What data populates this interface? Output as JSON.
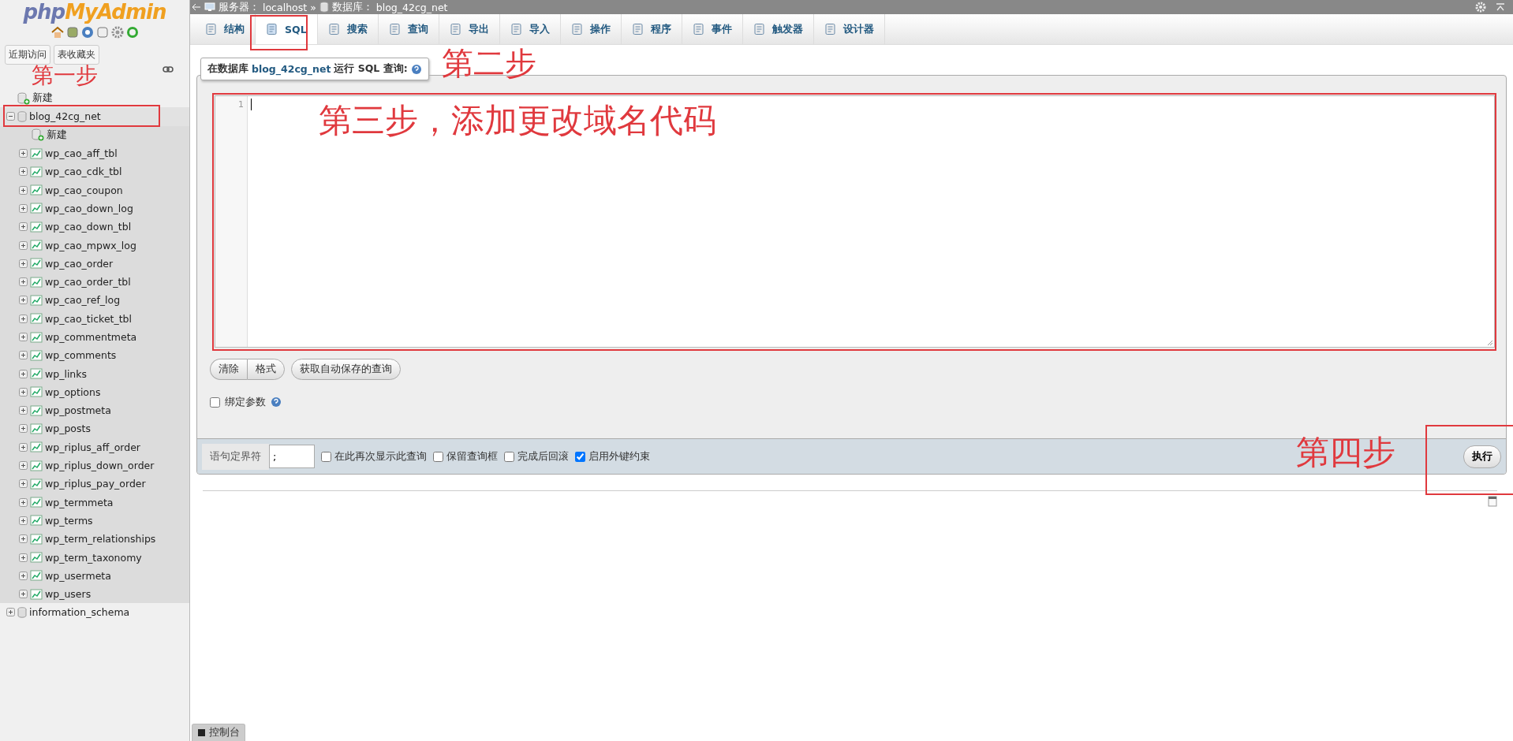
{
  "breadcrumb": {
    "server_label": "服务器：",
    "server": "localhost",
    "separator": "»",
    "db_label": "数据库：",
    "db": "blog_42cg_net"
  },
  "sidebar": {
    "logo": {
      "part1": "php",
      "part2": "MyAdmin"
    },
    "buttons": [
      "近期访问",
      "表收藏夹"
    ],
    "tree": [
      {
        "kind": "new",
        "label": "新建"
      },
      {
        "kind": "db",
        "label": "blog_42cg_net",
        "expanded": true,
        "children": [
          {
            "kind": "new",
            "label": "新建"
          },
          {
            "kind": "table",
            "label": "wp_cao_aff_tbl"
          },
          {
            "kind": "table",
            "label": "wp_cao_cdk_tbl"
          },
          {
            "kind": "table",
            "label": "wp_cao_coupon"
          },
          {
            "kind": "table",
            "label": "wp_cao_down_log"
          },
          {
            "kind": "table",
            "label": "wp_cao_down_tbl"
          },
          {
            "kind": "table",
            "label": "wp_cao_mpwx_log"
          },
          {
            "kind": "table",
            "label": "wp_cao_order"
          },
          {
            "kind": "table",
            "label": "wp_cao_order_tbl"
          },
          {
            "kind": "table",
            "label": "wp_cao_ref_log"
          },
          {
            "kind": "table",
            "label": "wp_cao_ticket_tbl"
          },
          {
            "kind": "table",
            "label": "wp_commentmeta"
          },
          {
            "kind": "table",
            "label": "wp_comments"
          },
          {
            "kind": "table",
            "label": "wp_links"
          },
          {
            "kind": "table",
            "label": "wp_options"
          },
          {
            "kind": "table",
            "label": "wp_postmeta"
          },
          {
            "kind": "table",
            "label": "wp_posts"
          },
          {
            "kind": "table",
            "label": "wp_riplus_aff_order"
          },
          {
            "kind": "table",
            "label": "wp_riplus_down_order"
          },
          {
            "kind": "table",
            "label": "wp_riplus_pay_order"
          },
          {
            "kind": "table",
            "label": "wp_termmeta"
          },
          {
            "kind": "table",
            "label": "wp_terms"
          },
          {
            "kind": "table",
            "label": "wp_term_relationships"
          },
          {
            "kind": "table",
            "label": "wp_term_taxonomy"
          },
          {
            "kind": "table",
            "label": "wp_usermeta"
          },
          {
            "kind": "table",
            "label": "wp_users"
          }
        ]
      },
      {
        "kind": "db",
        "label": "information_schema",
        "expanded": false
      }
    ]
  },
  "tabs": [
    {
      "label": "结构",
      "selected": false
    },
    {
      "label": "SQL",
      "selected": true
    },
    {
      "label": "搜索",
      "selected": false
    },
    {
      "label": "查询",
      "selected": false
    },
    {
      "label": "导出",
      "selected": false
    },
    {
      "label": "导入",
      "selected": false
    },
    {
      "label": "操作",
      "selected": false
    },
    {
      "label": "程序",
      "selected": false
    },
    {
      "label": "事件",
      "selected": false
    },
    {
      "label": "触发器",
      "selected": false
    },
    {
      "label": "设计器",
      "selected": false
    }
  ],
  "query_panel": {
    "title_prefix": "在数据库",
    "title_db": "blog_42cg_net",
    "title_suffix": "运行 SQL 查询:",
    "line_numbers": [
      "1"
    ],
    "button_groups": [
      [
        "清除",
        "格式"
      ],
      [
        "获取自动保存的查询"
      ]
    ],
    "bind_params": {
      "label": "绑定参数",
      "checked": false
    }
  },
  "footer": {
    "delimiter_label": "语句定界符",
    "delimiter": ";",
    "options": [
      {
        "label": "在此再次显示此查询",
        "checked": false
      },
      {
        "label": "保留查询框",
        "checked": false
      },
      {
        "label": "完成后回滚",
        "checked": false
      },
      {
        "label": "启用外键约束",
        "checked": true
      }
    ],
    "go": "执行"
  },
  "console": "控制台",
  "annotations": [
    {
      "text": "第一步"
    },
    {
      "text": "第二步"
    },
    {
      "text": "第三步，添加更改域名代码"
    },
    {
      "text": "第四步"
    }
  ]
}
